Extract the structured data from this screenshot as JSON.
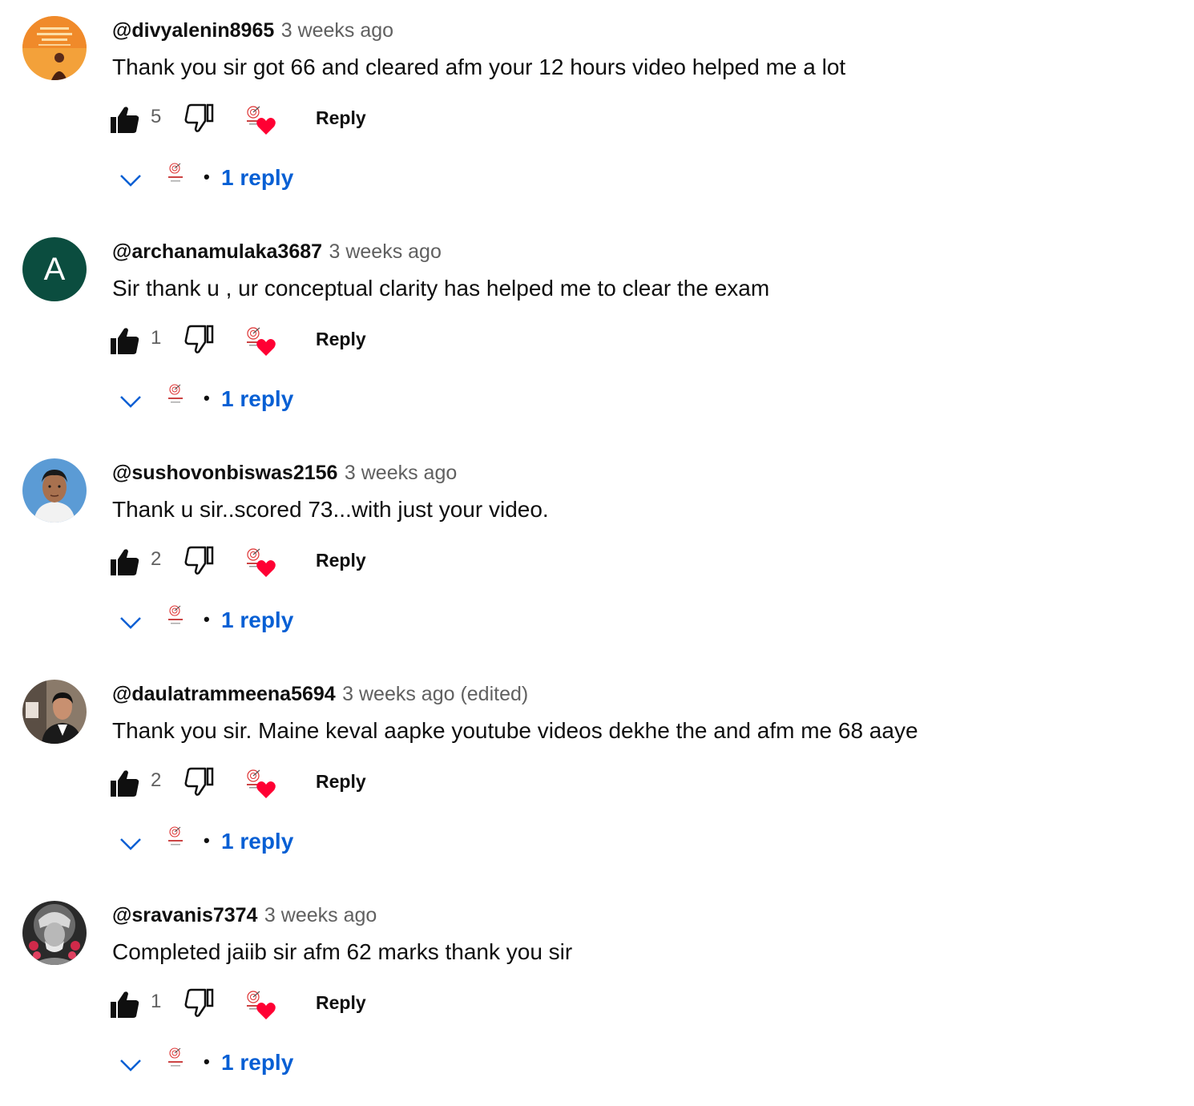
{
  "colors": {
    "link_blue": "#065fd4",
    "meta_gray": "#606060",
    "heart_red": "#ff0033"
  },
  "comments": [
    {
      "author": "@divyalenin8965",
      "time": "3 weeks ago",
      "text": "Thank you sir got 66 and cleared afm your 12 hours video helped me a lot",
      "likes": "5",
      "reply_label": "Reply",
      "replies_label": "1 reply",
      "avatar": "orange-poster-avatar"
    },
    {
      "author": "@archanamulaka3687",
      "time": "3 weeks ago",
      "text": "Sir thank u , ur conceptual clarity has helped me to clear the exam",
      "likes": "1",
      "reply_label": "Reply",
      "replies_label": "1 reply",
      "avatar_letter": "A",
      "avatar": "letter-avatar"
    },
    {
      "author": "@sushovonbiswas2156",
      "time": "3 weeks ago",
      "text": "Thank u sir..scored 73...with just your video.",
      "likes": "2",
      "reply_label": "Reply",
      "replies_label": "1 reply",
      "avatar": "portrait-avatar-blue"
    },
    {
      "author": "@daulatrammeena5694",
      "time": "3 weeks ago (edited)",
      "text": "Thank you sir. Maine keval aapke youtube videos dekhe the and afm me 68 aaye",
      "likes": "2",
      "reply_label": "Reply",
      "replies_label": "1 reply",
      "avatar": "portrait-avatar-suit"
    },
    {
      "author": "@sravanis7374",
      "time": "3 weeks ago",
      "text": "Completed jaiib sir afm 62 marks thank you sir",
      "likes": "1",
      "reply_label": "Reply",
      "replies_label": "1 reply",
      "avatar": "saint-portrait-avatar"
    }
  ]
}
